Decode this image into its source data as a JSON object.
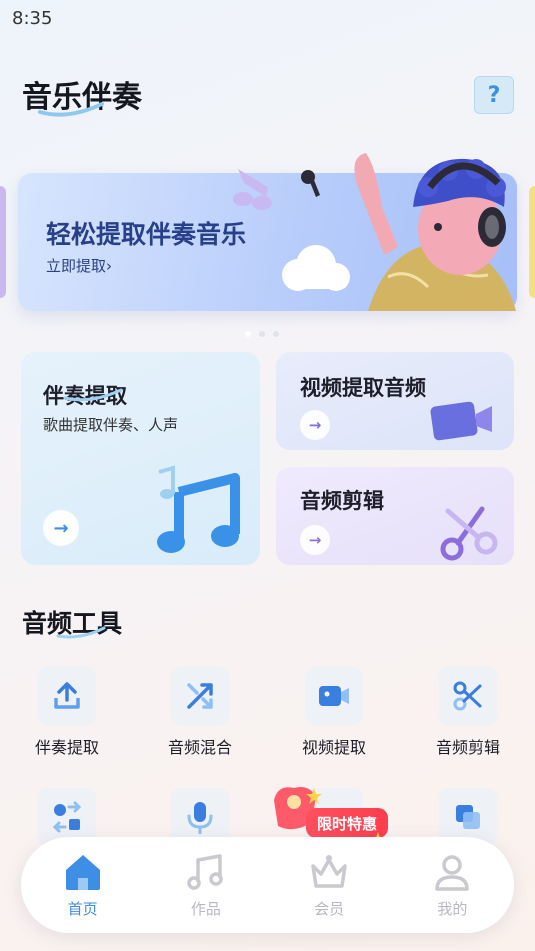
{
  "status_bar": {
    "time": "8:35"
  },
  "header": {
    "title": "音乐伴奏",
    "help_label": "?"
  },
  "banner": {
    "title": "轻松提取伴奏音乐",
    "link_label": "立即提取",
    "link_chevron": "›",
    "pages": 3,
    "active_page": 1
  },
  "cards": {
    "accompaniment": {
      "title": "伴奏提取",
      "subtitle": "歌曲提取伴奏、人声",
      "arrow": "→"
    },
    "video_audio": {
      "title": "视频提取音频",
      "arrow": "→"
    },
    "audio_edit": {
      "title": "音频剪辑",
      "arrow": "→"
    }
  },
  "tools": {
    "title": "音频工具",
    "items": [
      {
        "label": "伴奏提取",
        "icon": "upload-icon"
      },
      {
        "label": "音频混合",
        "icon": "shuffle-icon"
      },
      {
        "label": "视频提取",
        "icon": "video-camera-icon"
      },
      {
        "label": "音频剪辑",
        "icon": "scissors-icon"
      }
    ],
    "row2_icons": [
      "convert-icon",
      "microphone-icon",
      "gift-icon",
      "layers-icon"
    ]
  },
  "promo": {
    "label": "限时特惠"
  },
  "bottom_nav": {
    "items": [
      {
        "label": "首页",
        "icon": "home-icon",
        "active": true
      },
      {
        "label": "作品",
        "icon": "music-note-icon",
        "active": false
      },
      {
        "label": "会员",
        "icon": "crown-icon",
        "active": false
      },
      {
        "label": "我的",
        "icon": "user-icon",
        "active": false
      }
    ]
  },
  "colors": {
    "accent_blue": "#3e8ee6",
    "banner_title": "#28408a",
    "promo_red": "#ff4557",
    "purple": "#8a72d8"
  }
}
